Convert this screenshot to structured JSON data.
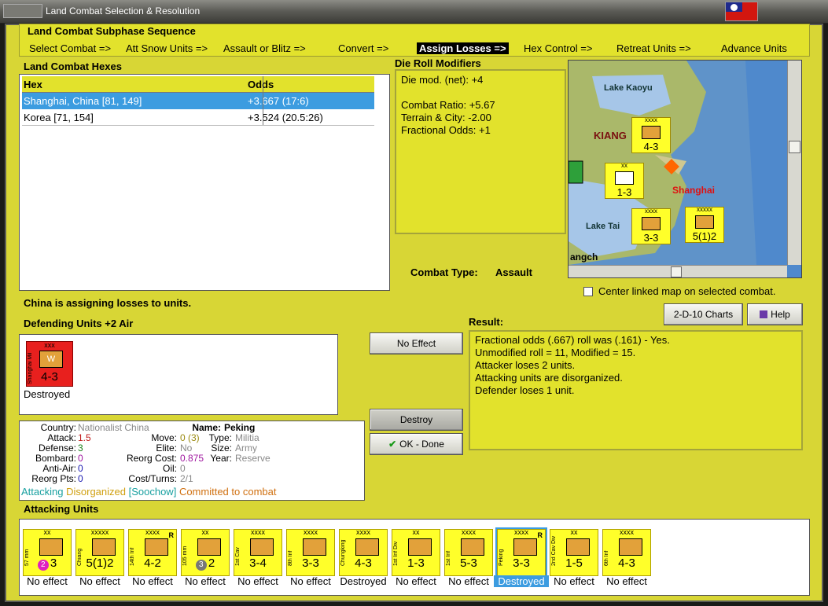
{
  "window": {
    "title": "Land Combat Selection & Resolution"
  },
  "sequence": {
    "title": "Land Combat Subphase Sequence",
    "steps": [
      "Select Combat =>",
      "Att Snow Units =>",
      "Assault or Blitz =>",
      "Convert =>",
      "Assign Losses =>",
      "Hex Control =>",
      "Retreat Units =>",
      "Advance Units"
    ],
    "active": "Assign Losses =>"
  },
  "hexes": {
    "title": "Land Combat Hexes",
    "headers": [
      "Hex",
      "Odds"
    ],
    "rows": [
      {
        "hex": "Shanghai, China [81, 149]",
        "odds": "+3.667 (17:6)"
      },
      {
        "hex": "Korea [71, 154]",
        "odds": "+3.524 (20.5:26)"
      }
    ]
  },
  "die_mods": {
    "title": "Die Roll Modifiers",
    "net": "Die mod. (net): +4",
    "ratio": "Combat Ratio: +5.67",
    "terrain": "Terrain & City: -2.00",
    "fraction": "Fractional Odds: +1"
  },
  "map": {
    "labels": [
      "Lake Kaoyu",
      "KIANG",
      "Shanghai",
      "Lake Tai",
      "angch"
    ],
    "tiles": [
      {
        "size": "xxxx",
        "str": "4-3"
      },
      {
        "size": "xx",
        "str": "1-3"
      },
      {
        "size": "xxxx",
        "str": "3-3"
      },
      {
        "size": "xxxxx",
        "str": "5(1)2"
      }
    ]
  },
  "combat_type": {
    "label": "Combat Type:",
    "value": "Assault"
  },
  "center_map": {
    "label": "Center linked map on selected combat."
  },
  "status_msg": "China is assigning losses to units.",
  "buttons": {
    "charts": "2-D-10 Charts",
    "help": "Help",
    "no_effect": "No Effect",
    "destroy": "Destroy",
    "done": "OK - Done"
  },
  "defending": {
    "title": "Defending Units +2 Air",
    "unit": {
      "name": "Shanghai Mil",
      "size": "xxx",
      "letter": "W",
      "strength": "4-3",
      "status": "Destroyed"
    }
  },
  "unit_info": {
    "country_k": "Country:",
    "country_v": "Nationalist China",
    "attack_k": "Attack:",
    "attack_v": "1.5",
    "defense_k": "Defense:",
    "defense_v": "3",
    "bombard_k": "Bombard:",
    "bombard_v": "0",
    "antiair_k": "Anti-Air:",
    "antiair_v": "0",
    "reorgpts_k": "Reorg Pts:",
    "reorgpts_v": "0",
    "name_k": "Name:",
    "name_v": "Peking",
    "move_k": "Move:",
    "move_v": "0 (3)",
    "elite_k": "Elite:",
    "elite_v": "No",
    "reorgcost_k": "Reorg Cost:",
    "reorgcost_v": "0.875",
    "oil_k": "Oil:",
    "oil_v": "0",
    "cost_k": "Cost/Turns:",
    "cost_v": "2/1",
    "type_k": "Type:",
    "type_v": "Militia",
    "size_k": "Size:",
    "size_v": "Army",
    "year_k": "Year:",
    "year_v": "Reserve",
    "flag1": "Attacking",
    "flag2": "Disorganized",
    "flag3": "[Soochow]",
    "flag4": "Committed to combat"
  },
  "result": {
    "title": "Result:",
    "lines": [
      "Fractional odds (.667) roll was (.161)  - Yes.",
      "Unmodified roll = 11, Modified = 15.",
      "Attacker loses 2 units.",
      "Attacking units are disorganized.",
      "Defender loses 1 unit."
    ]
  },
  "attacking": {
    "title": "Attacking Units",
    "units": [
      {
        "name": "57 mm",
        "size": "xx",
        "str": "3",
        "badge": "2",
        "status": "No effect"
      },
      {
        "name": "Chiang",
        "size": "xxxxx",
        "str": "5(1)2",
        "status": "No effect"
      },
      {
        "name": "14th Inf",
        "size": "xxxx",
        "str": "4-2",
        "r": "R",
        "status": "No effect"
      },
      {
        "name": "105 mm",
        "size": "xx",
        "str": "2",
        "badge": "3",
        "status": "No effect"
      },
      {
        "name": "1st Cav",
        "size": "xxxx",
        "str": "3-4",
        "status": "No effect"
      },
      {
        "name": "8th Inf",
        "size": "xxxx",
        "str": "3-3",
        "status": "No effect"
      },
      {
        "name": "Chungking",
        "size": "xxxx",
        "str": "4-3",
        "status": "Destroyed"
      },
      {
        "name": "1st Inf Div",
        "size": "xx",
        "str": "1-3",
        "status": "No effect"
      },
      {
        "name": "1st Inf",
        "size": "xxxx",
        "str": "5-3",
        "status": "No effect"
      },
      {
        "name": "Peking",
        "size": "xxxx",
        "str": "3-3",
        "r": "R",
        "status": "Destroyed"
      },
      {
        "name": "2nd Cav Div",
        "size": "xx",
        "str": "1-5",
        "status": "No effect"
      },
      {
        "name": "6th Inf",
        "size": "xxxx",
        "str": "4-3",
        "status": "No effect"
      }
    ]
  },
  "colors": {
    "panel": "#e2e22c",
    "frame": "#d8d635",
    "selected": "#3c9ce0",
    "unit": "#ffff2a",
    "destroyed": "#e8201e"
  }
}
